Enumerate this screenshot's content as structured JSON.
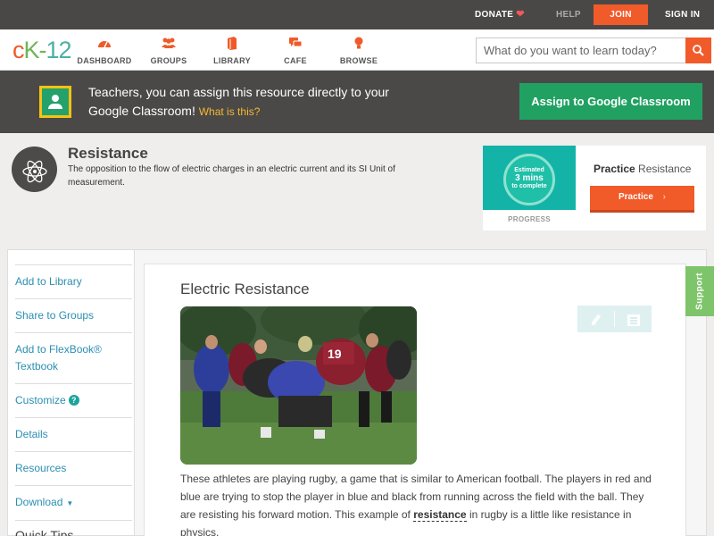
{
  "topbar": {
    "donate": "DONATE",
    "help": "HELP",
    "join": "JOIN",
    "signin": "SIGN IN"
  },
  "logo": {
    "text": "CK-12"
  },
  "nav": {
    "items": [
      {
        "label": "DASHBOARD",
        "icon": "dashboard-icon"
      },
      {
        "label": "GROUPS",
        "icon": "groups-icon"
      },
      {
        "label": "LIBRARY",
        "icon": "library-icon"
      },
      {
        "label": "CAFE",
        "icon": "cafe-icon"
      },
      {
        "label": "BROWSE",
        "icon": "browse-icon"
      }
    ],
    "search_placeholder": "What do you want to learn today?"
  },
  "banner": {
    "text": "Teachers, you can assign this resource directly to your Google Classroom!",
    "link": "What is this?",
    "button": "Assign to Google Classroom"
  },
  "concept": {
    "title": "Resistance",
    "description": "The opposition to the flow of electric charges in an electric current and its SI Unit of measurement."
  },
  "progress": {
    "estimated_top": "Estimated",
    "estimated_mins": "3 mins",
    "estimated_bottom": "to complete",
    "label": "PROGRESS",
    "practice_bold": "Practice",
    "practice_topic": "Resistance",
    "practice_button": "Practice"
  },
  "sidebar": {
    "items": [
      "Add to Library",
      "Share to Groups",
      "Add to FlexBook® Textbook",
      "Customize",
      "Details",
      "Resources",
      "Download"
    ],
    "quick_tips": "Quick Tips"
  },
  "article": {
    "title": "Electric Resistance",
    "para_1": "These athletes are playing rugby, a game that is similar to American football. The players in red and blue are trying to stop the player in blue and black from running across the field with the ball. They are resisting his forward motion. This example of",
    "keyword": "resistance",
    "para_2": "in rugby is a little like resistance in physics.",
    "jersey_number": "19"
  },
  "support": {
    "label": "Support"
  },
  "colors": {
    "accent": "#f15a29",
    "google_green": "#20a162",
    "link_blue": "#2b8fb1",
    "teal": "#14b3a8"
  }
}
